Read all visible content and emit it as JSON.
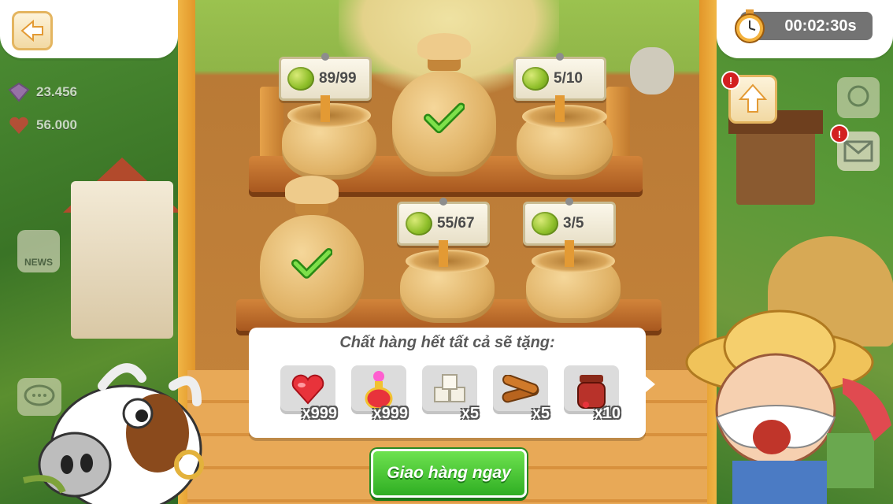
{
  "hud": {
    "timer": "00:02:30s",
    "stats": [
      {
        "name": "gems",
        "value": "23.456"
      },
      {
        "name": "hearts",
        "value": "56.000"
      }
    ],
    "news_label": "NEWS"
  },
  "sacks": [
    {
      "id": "sack-1",
      "state": "open",
      "count": "89/99"
    },
    {
      "id": "sack-2",
      "state": "filled",
      "count": ""
    },
    {
      "id": "sack-3",
      "state": "open",
      "count": "5/10"
    },
    {
      "id": "sack-4",
      "state": "filled",
      "count": ""
    },
    {
      "id": "sack-5",
      "state": "open",
      "count": "55/67"
    },
    {
      "id": "sack-6",
      "state": "open",
      "count": "3/5"
    }
  ],
  "reward": {
    "title": "Chất hàng hết tất cả sẽ tặng:",
    "items": [
      {
        "icon": "heart-icon",
        "qty": "x999"
      },
      {
        "icon": "potion-icon",
        "qty": "x999"
      },
      {
        "icon": "sugar-cubes-icon",
        "qty": "x5"
      },
      {
        "icon": "logs-icon",
        "qty": "x5"
      },
      {
        "icon": "jam-jar-icon",
        "qty": "x10"
      }
    ]
  },
  "deliver_button": "Giao hàng ngay",
  "colors": {
    "deliver_green": "#2fae23",
    "sign_bg": "#fbf7ea",
    "panel_bg": "#ffffff",
    "timer_bg": "#737373"
  }
}
